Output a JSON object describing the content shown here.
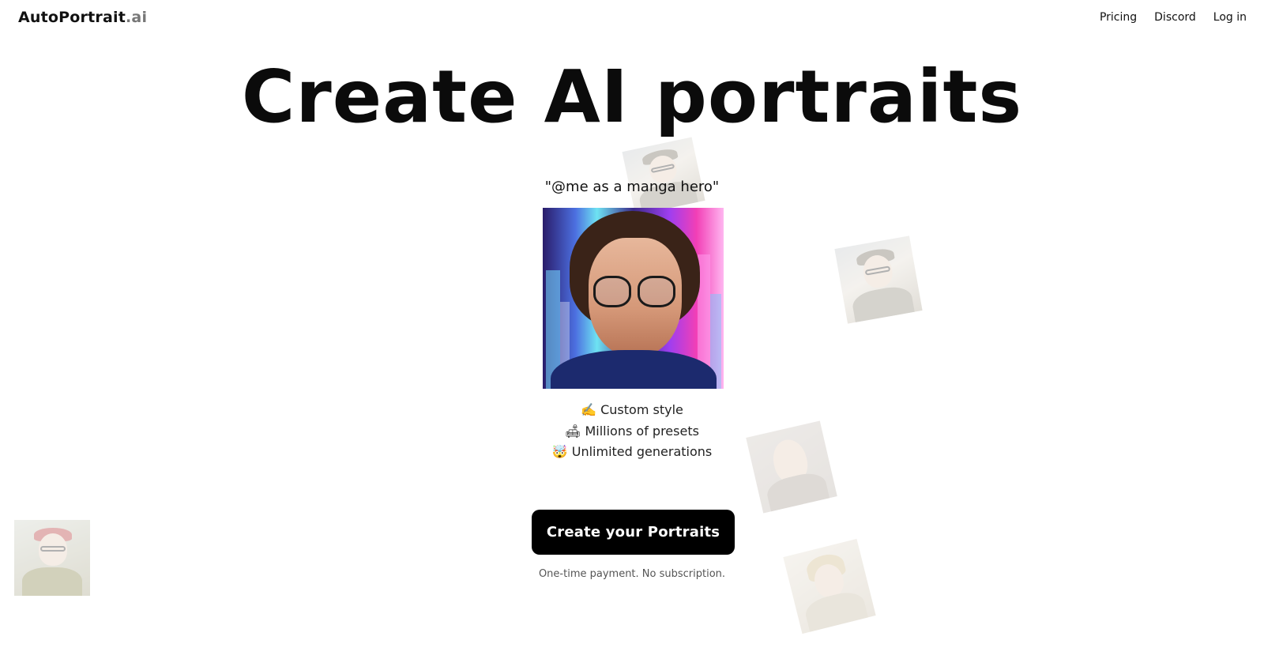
{
  "nav": {
    "logo_main": "AutoPortrait",
    "logo_suffix": ".ai",
    "links": [
      "Pricing",
      "Discord",
      "Log in"
    ]
  },
  "hero": {
    "title": "Create AI portraits",
    "prompt": "\"@me as a manga hero\""
  },
  "features": [
    "✍️ Custom style",
    "🛋 Millions of presets",
    "🤯 Unlimited generations"
  ],
  "cta": {
    "label": "Create your Portraits",
    "note": "One-time payment. No subscription."
  }
}
